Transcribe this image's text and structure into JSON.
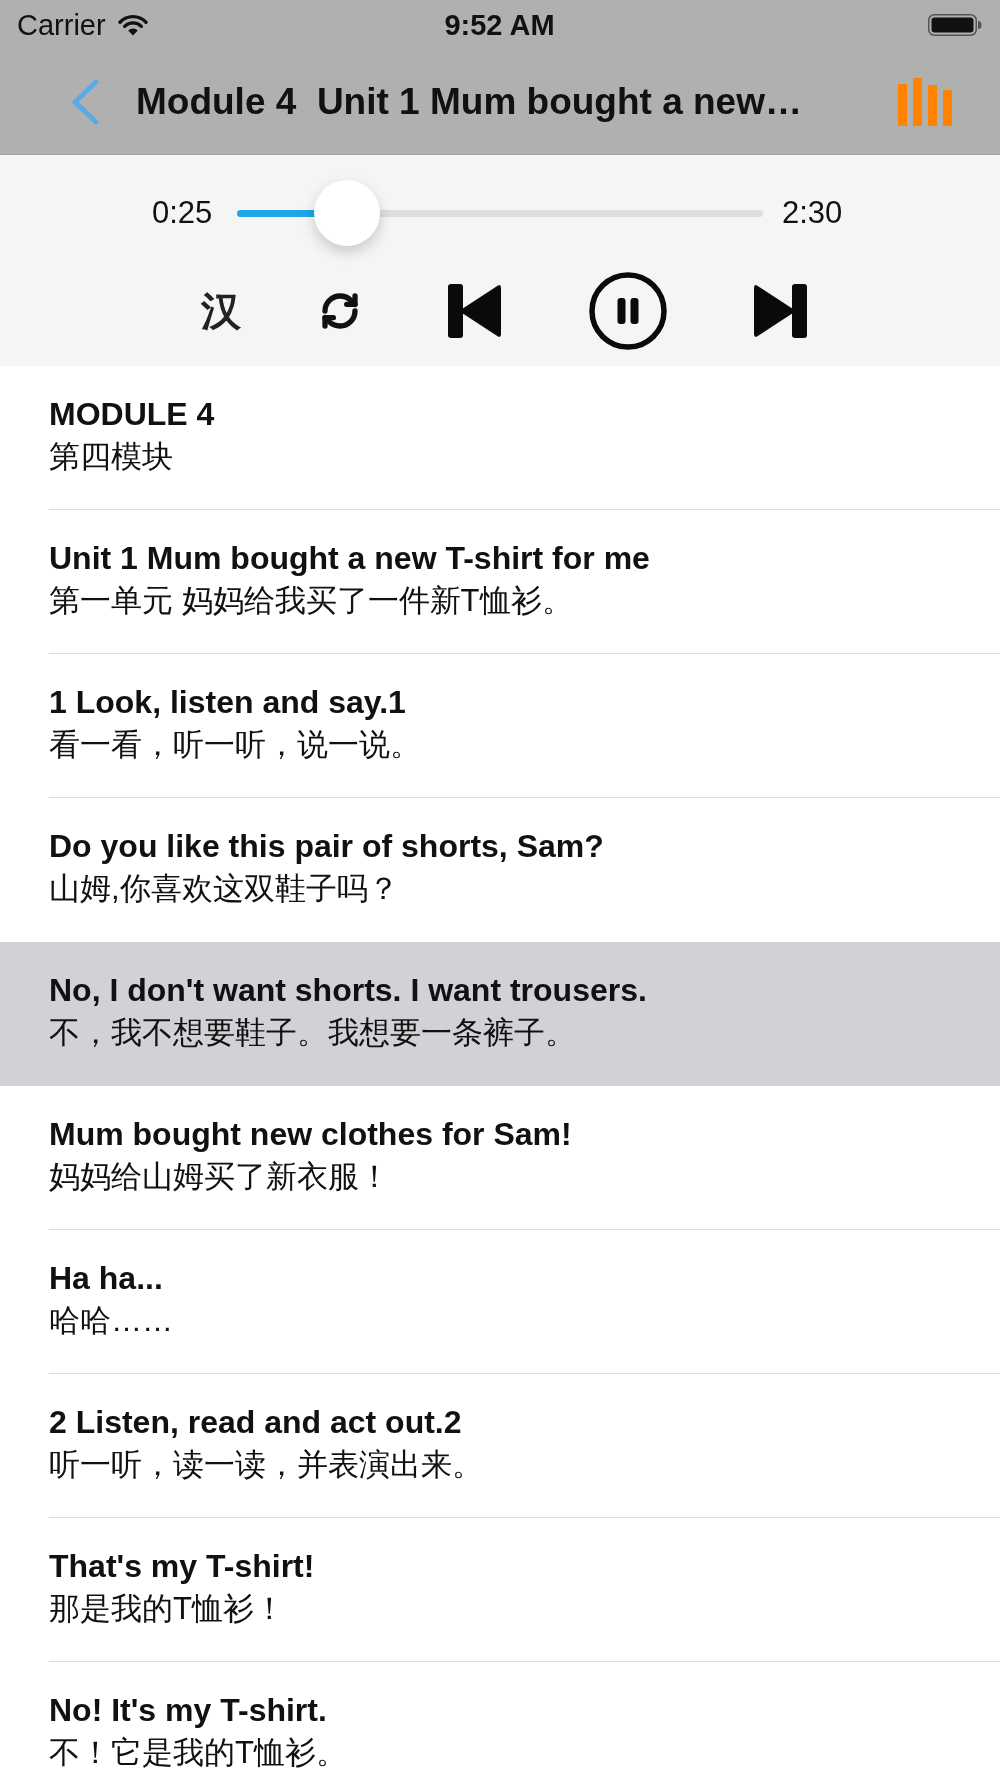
{
  "status_bar": {
    "carrier": "Carrier",
    "time": "9:52 AM"
  },
  "nav_bar": {
    "title": "Module 4  Unit 1 Mum bought a new…"
  },
  "player": {
    "elapsed": "0:25",
    "duration": "2:30",
    "level": 0.21,
    "playing": true,
    "translation_toggle": "汉"
  },
  "sentences": [
    {
      "english": "MODULE 4",
      "chinese": "第四模块",
      "selected": false
    },
    {
      "english": "Unit 1 Mum bought a new T-shirt for me",
      "chinese": "第一单元 妈妈给我买了一件新T恤衫。",
      "selected": false
    },
    {
      "english": "1 Look, listen and say.1",
      "chinese": "看一看，听一听，说一说。",
      "selected": false
    },
    {
      "english": "Do you like this pair of shorts, Sam?",
      "chinese": "山姆,你喜欢这双鞋子吗？",
      "selected": false
    },
    {
      "english": "No, I don't want shorts. I want trousers.",
      "chinese": "不，我不想要鞋子。我想要一条裤子。",
      "selected": true
    },
    {
      "english": "Mum bought new clothes for Sam!",
      "chinese": "妈妈给山姆买了新衣服！",
      "selected": false
    },
    {
      "english": "Ha ha...",
      "chinese": "哈哈……",
      "selected": false
    },
    {
      "english": "2 Listen, read and act out.2",
      "chinese": "听一听，读一读，并表演出来。",
      "selected": false
    },
    {
      "english": "That's my T-shirt!",
      "chinese": "那是我的T恤衫！",
      "selected": false
    },
    {
      "english": "No! It's my T-shirt.",
      "chinese": "不！它是我的T恤衫。",
      "selected": false
    }
  ]
}
